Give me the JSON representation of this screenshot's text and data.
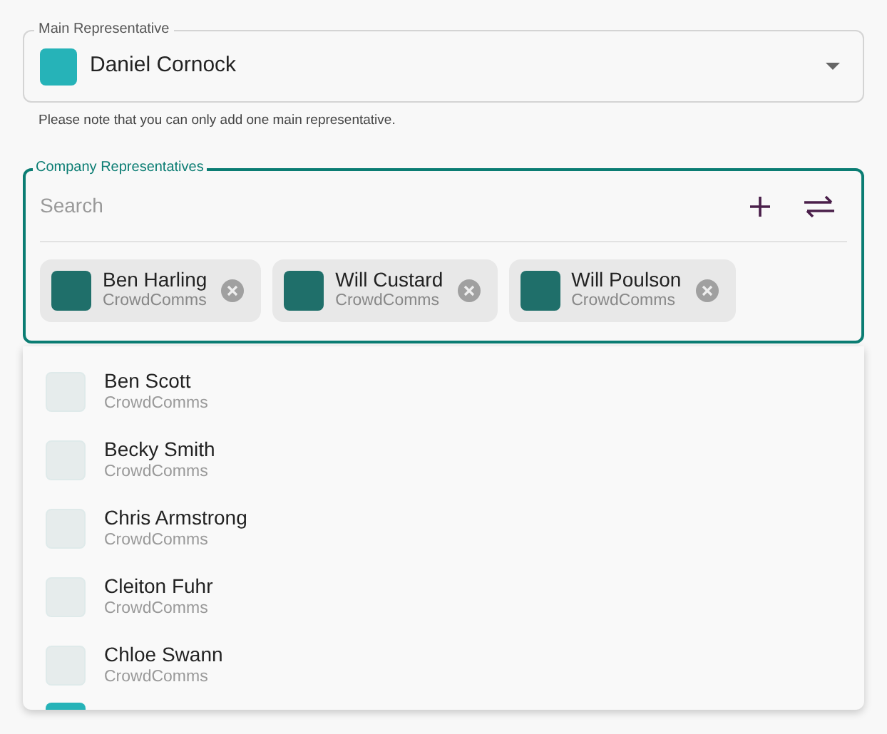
{
  "main_representative": {
    "label": "Main Representative",
    "value": {
      "name": "Daniel Cornock"
    },
    "helper": "Please note that you can only add one main representative."
  },
  "company_representatives": {
    "label": "Company Representatives",
    "search": {
      "placeholder": "Search"
    },
    "chips": [
      {
        "name": "Ben Harling",
        "company": "CrowdComms"
      },
      {
        "name": "Will Custard",
        "company": "CrowdComms"
      },
      {
        "name": "Will Poulson",
        "company": "CrowdComms"
      }
    ]
  },
  "options": [
    {
      "name": "Ben Scott",
      "company": "CrowdComms"
    },
    {
      "name": "Becky Smith",
      "company": "CrowdComms"
    },
    {
      "name": "Chris Armstrong",
      "company": "CrowdComms"
    },
    {
      "name": "Cleiton Fuhr",
      "company": "CrowdComms"
    },
    {
      "name": "Chloe Swann",
      "company": "CrowdComms"
    }
  ]
}
